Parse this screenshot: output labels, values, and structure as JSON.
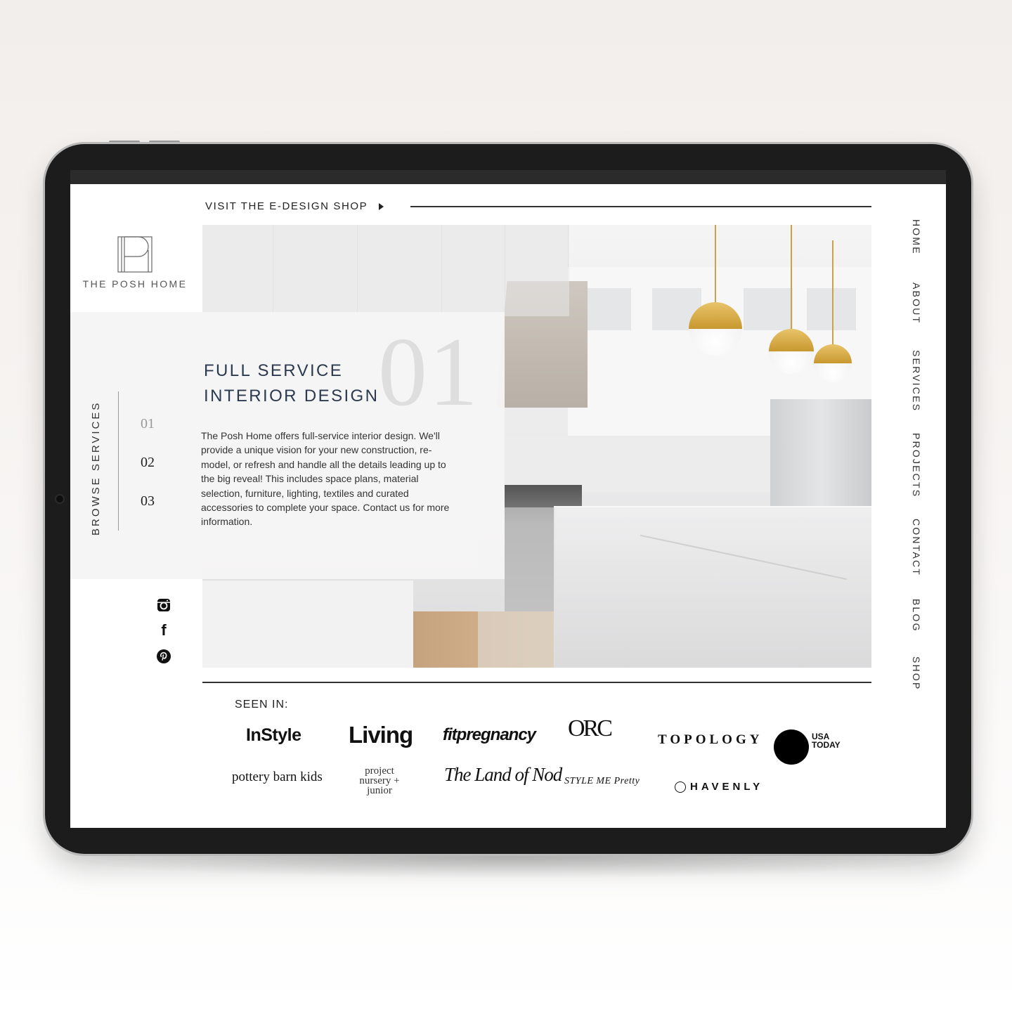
{
  "promo": {
    "label": "VISIT THE E-DESIGN SHOP"
  },
  "logo": {
    "brand": "THE POSH HOME"
  },
  "services": {
    "browse_label": "BROWSE SERVICES",
    "numbers": [
      "01",
      "02",
      "03"
    ],
    "active_number": "01",
    "title_line1": "FULL SERVICE",
    "title_line2": "INTERIOR DESIGN",
    "description": "The Posh Home offers full-service interior design. We'll provide a unique vision for your new construction, re-model, or refresh and handle all the details leading up to the big reveal! This includes space plans, material selection, furniture, lighting, textiles and curated accessories to complete your space. Contact us for more information."
  },
  "social": [
    "instagram-icon",
    "facebook-icon",
    "pinterest-icon"
  ],
  "facebook_glyph": "f",
  "nav": [
    "HOME",
    "ABOUT",
    "SERVICES",
    "PROJECTS",
    "CONTACT",
    "BLOG",
    "SHOP"
  ],
  "seen_in": {
    "label": "SEEN IN:",
    "publications": {
      "instyle": "InStyle",
      "living": "Living",
      "fitpregnancy": "fitpregnancy",
      "orc": "ORC",
      "topology": "TOPOLOGY",
      "usatoday": "USA TODAY",
      "pbk": "pottery barn kids",
      "project_nursery": "project nursery + junior",
      "land_of_nod": "The Land of Nod",
      "style_me_pretty": "STYLE ME Pretty",
      "havenly": "HAVENLY"
    }
  },
  "colors": {
    "title_navy": "#2c3a4f",
    "card_bg": "#f6f5f5",
    "bezel": "#1c1c1c",
    "pendant_gold": "#c8982f"
  }
}
